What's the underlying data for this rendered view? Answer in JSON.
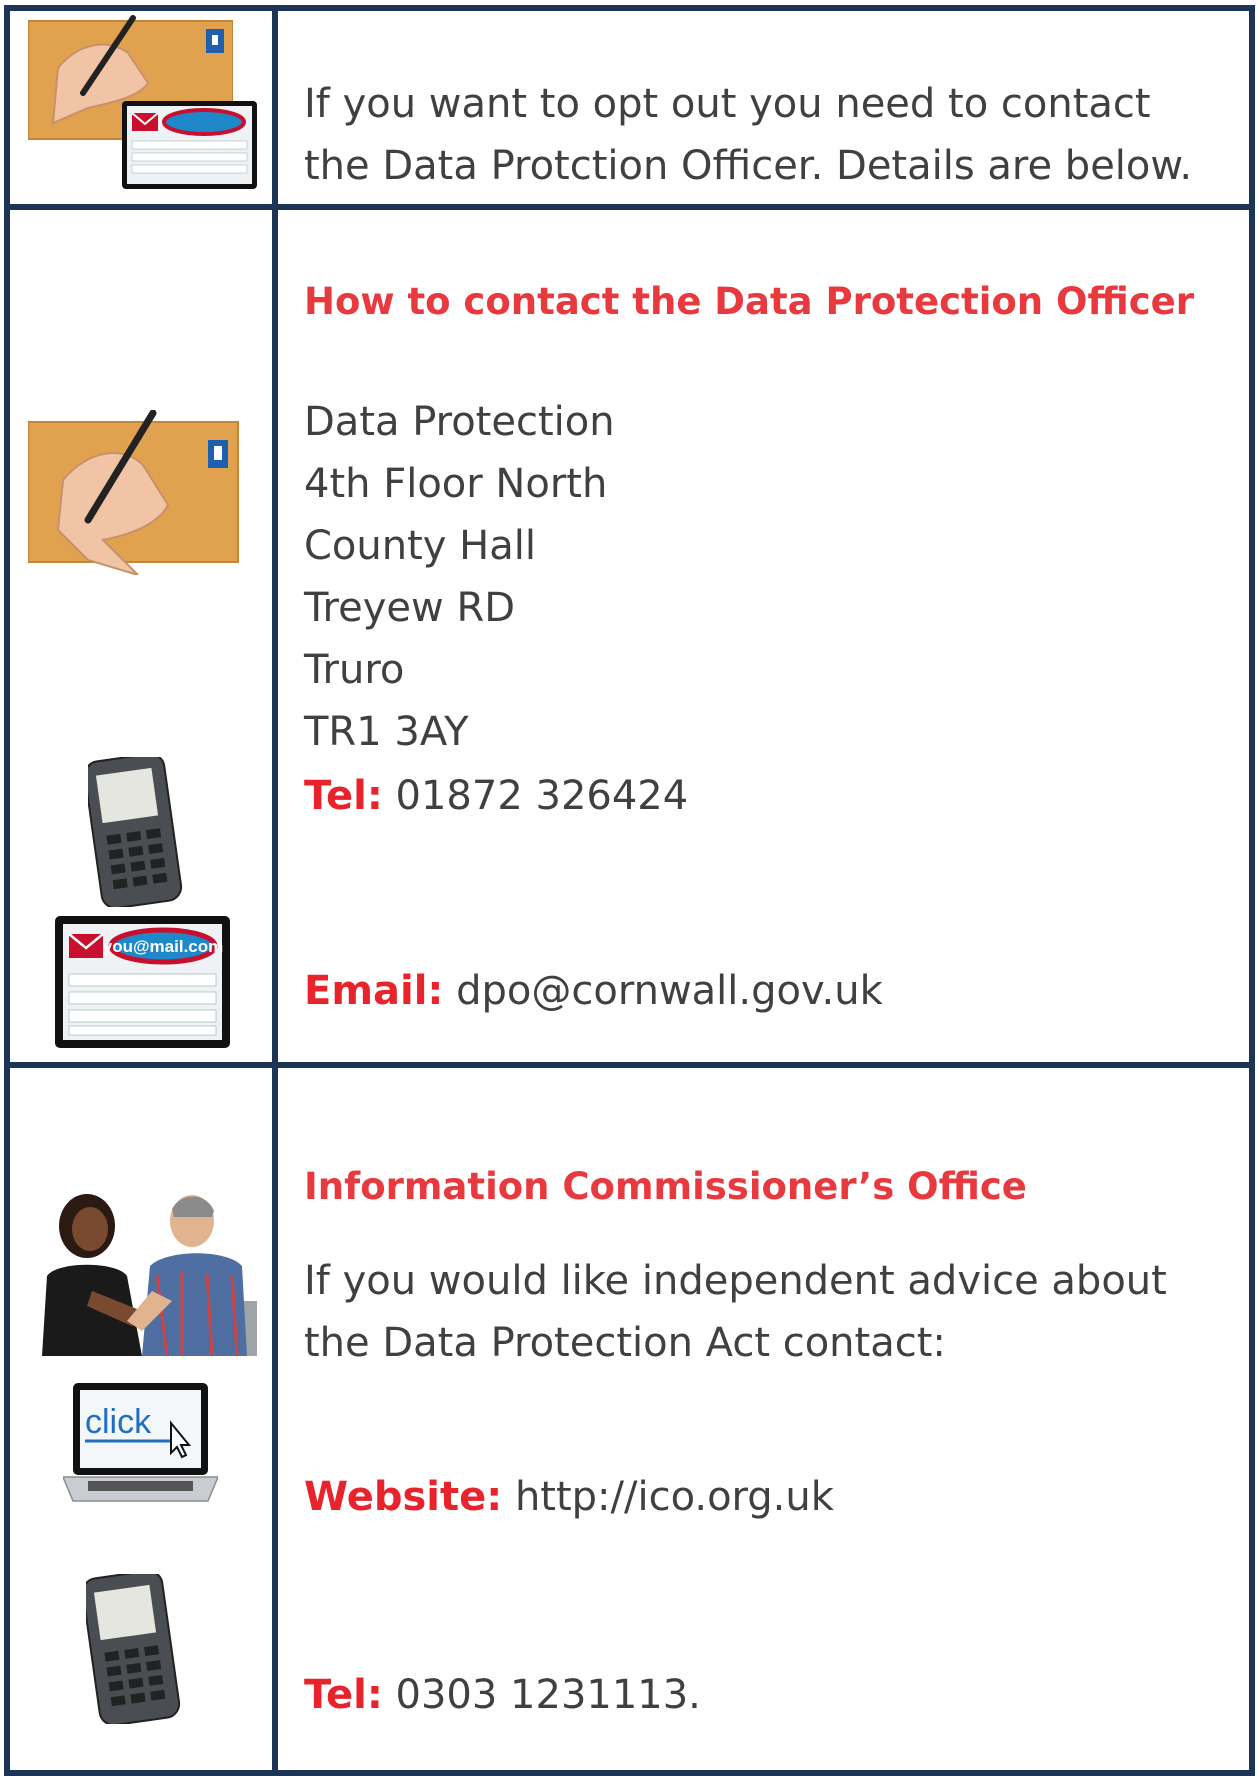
{
  "row1": {
    "text": "If you want to opt out you need to contact the Data Protction Officer. Details are below.",
    "line1": "If you want to opt out you need to contact",
    "line2": "the Data Protction Officer. Details are below.",
    "icons": [
      "letter-writing-icon",
      "email-tablet-icon"
    ]
  },
  "row2": {
    "heading": "How to contact the Data Protection Officer",
    "address": [
      "Data Protection",
      "4th Floor North",
      "County Hall",
      "Treyew RD",
      "Truro",
      "TR1 3AY"
    ],
    "tel_label": "Tel:",
    "tel_value": " 01872 326424",
    "email_label": "Email:",
    "email_value": " dpo@cornwall.gov.uk",
    "tablet_email_text": "you@mail.com",
    "icons": [
      "letter-writing-icon",
      "mobile-phone-icon",
      "email-tablet-icon"
    ]
  },
  "row3": {
    "heading": "Information Commissioner’s Office",
    "line1": "If you would like independent advice about",
    "line2": "the Data Protection Act contact:",
    "website_label": "Website:",
    "website_value": " http://ico.org.uk",
    "tel_label": "Tel:",
    "tel_value": " 0303 1231113.",
    "laptop_text": "click",
    "icons": [
      "people-talking-icon",
      "laptop-click-icon",
      "mobile-phone-icon"
    ]
  },
  "colors": {
    "border": "#1c3557",
    "heading": "#e8393f",
    "label": "#e8232b",
    "body": "#404040",
    "envelope": "#e0a24e",
    "tablet_accent": "#c8102e"
  }
}
